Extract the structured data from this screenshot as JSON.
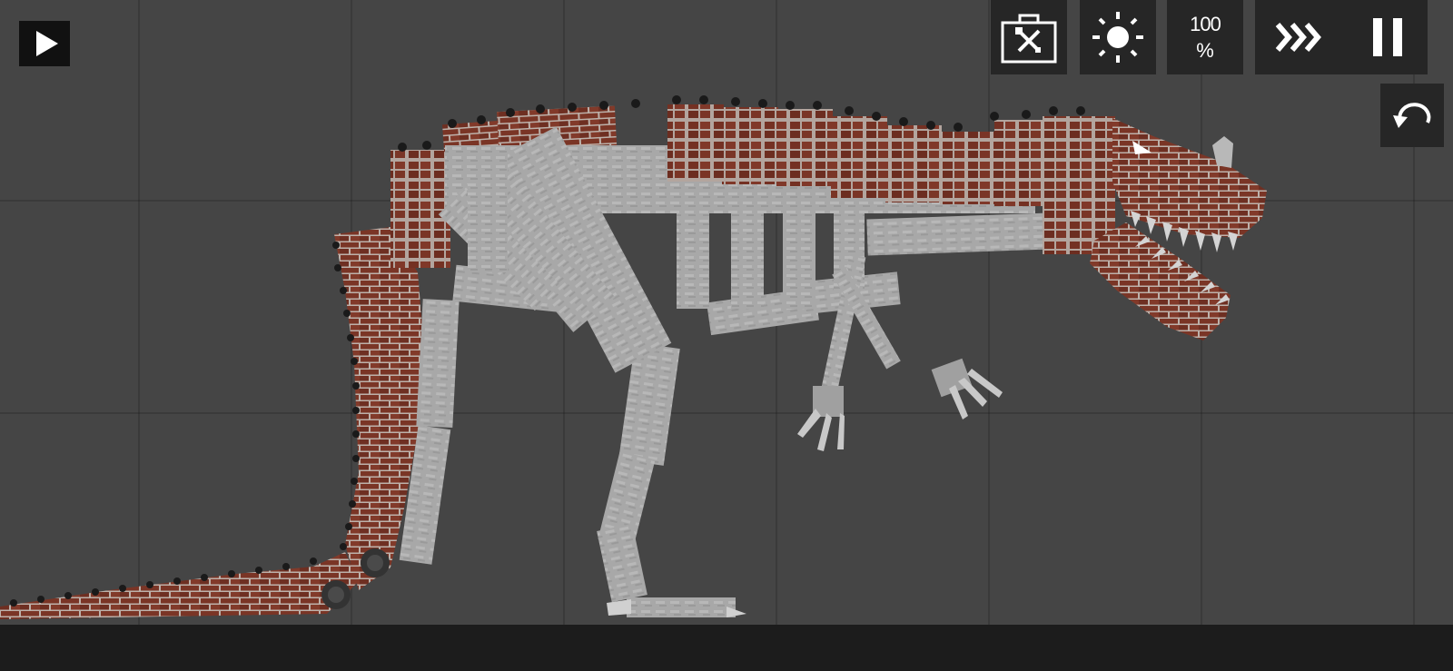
{
  "toolbar": {
    "play_icon": "play-icon",
    "toolbox_icon": "toolbox-icon",
    "light_icon": "sun-icon",
    "speed_value": "100",
    "speed_unit": "%",
    "fast_forward_icon": "fast-forward-icon",
    "pause_icon": "pause-icon",
    "undo_icon": "undo-icon"
  },
  "scene": {
    "creature": "brick-and-bone-dinosaur"
  },
  "colors": {
    "background": "#454545",
    "grid_line": "#3b3b3b",
    "ground": "#1c1c1c",
    "button": "#262626",
    "brick": "#7a3526",
    "mortar": "#b8a8a0",
    "bone": "#a9a9a9",
    "bone_light": "#c4c4c4",
    "rivet": "#1a1a1a"
  }
}
